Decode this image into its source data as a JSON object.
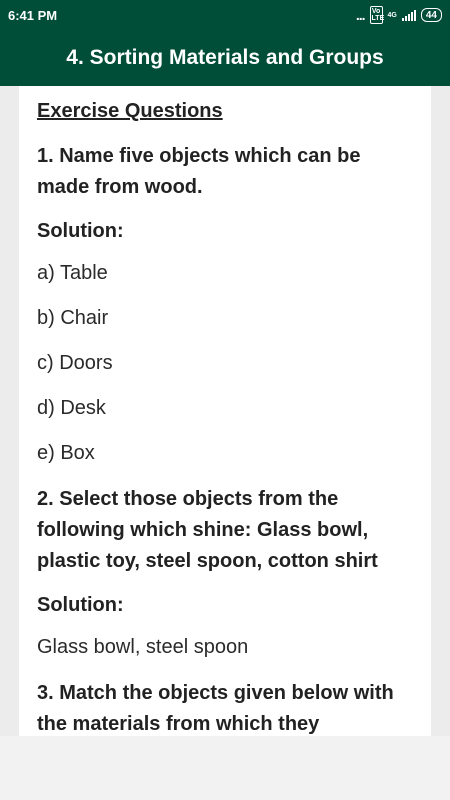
{
  "status_bar": {
    "time": "6:41 PM",
    "dots": "...",
    "volte": "Vo LTE",
    "network": "4G",
    "battery": "44"
  },
  "app_bar": {
    "title": "4. Sorting Materials and Groups"
  },
  "content": {
    "heading": "Exercise Questions",
    "q1": "1. Name five objects which can be made from wood.",
    "solution_label_1": "Solution:",
    "answers_1": [
      "a) Table",
      "b) Chair",
      "c) Doors",
      "d) Desk",
      "e) Box"
    ],
    "q2": "2. Select those objects from the following which shine: Glass bowl, plastic toy, steel spoon, cotton shirt",
    "solution_label_2": "Solution:",
    "answer_2": "Glass bowl, steel spoon",
    "q3": "3. Match the objects given below with the materials from which they"
  },
  "colors": {
    "app_bar": "#004d38",
    "card": "#ffffff",
    "background": "#ececec"
  }
}
